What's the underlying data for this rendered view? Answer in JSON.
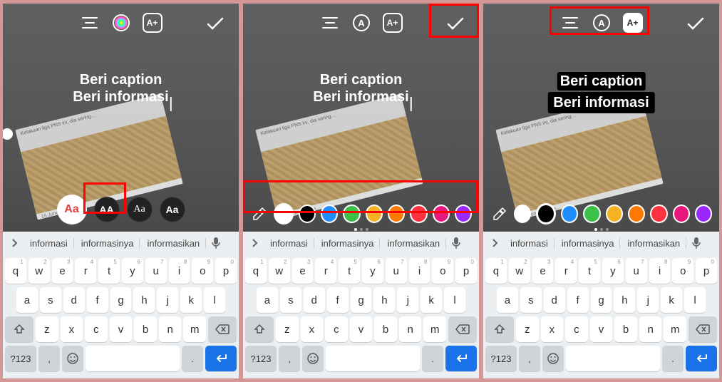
{
  "caption": {
    "line1": "Beri caption",
    "line2": "Beri informasi"
  },
  "topbar": {
    "align_icon": "align-center-icon",
    "color_icon": "color-wheel-icon",
    "font_outline_icon": "A",
    "bg_icon": "A+",
    "confirm_icon": "check-icon"
  },
  "font_styles": [
    {
      "label": "Aa",
      "selected": true,
      "variant": "classic"
    },
    {
      "label": "AA",
      "selected": false,
      "variant": "modern"
    },
    {
      "label": "Aa",
      "selected": false,
      "variant": "script"
    },
    {
      "label": "Aa",
      "selected": false,
      "variant": "bold"
    }
  ],
  "colors": [
    "#ffffff",
    "#000000",
    "#1f8fff",
    "#3bc14a",
    "#f5b324",
    "#ff7a00",
    "#ff3340",
    "#e6187e",
    "#9b27ff"
  ],
  "selected_color_index_panel2": 0,
  "selected_color_index_panel3": 1,
  "suggestions": {
    "s1": "informasi",
    "s2": "informasinya",
    "s3": "informasikan"
  },
  "keyboard": {
    "row1": [
      "q",
      "w",
      "e",
      "r",
      "t",
      "y",
      "u",
      "i",
      "o",
      "p"
    ],
    "row1_nums": [
      "1",
      "2",
      "3",
      "4",
      "5",
      "6",
      "7",
      "8",
      "9",
      "0"
    ],
    "row2": [
      "a",
      "s",
      "d",
      "f",
      "g",
      "h",
      "j",
      "k",
      "l"
    ],
    "row3": [
      "z",
      "x",
      "c",
      "v",
      "b",
      "n",
      "m"
    ],
    "symkey": "?123",
    "comma": ",",
    "period": "."
  },
  "tilted_card": {
    "header": "Kelakuan liga PNS ini, dia sering…",
    "footer": "15 June yang la…"
  }
}
